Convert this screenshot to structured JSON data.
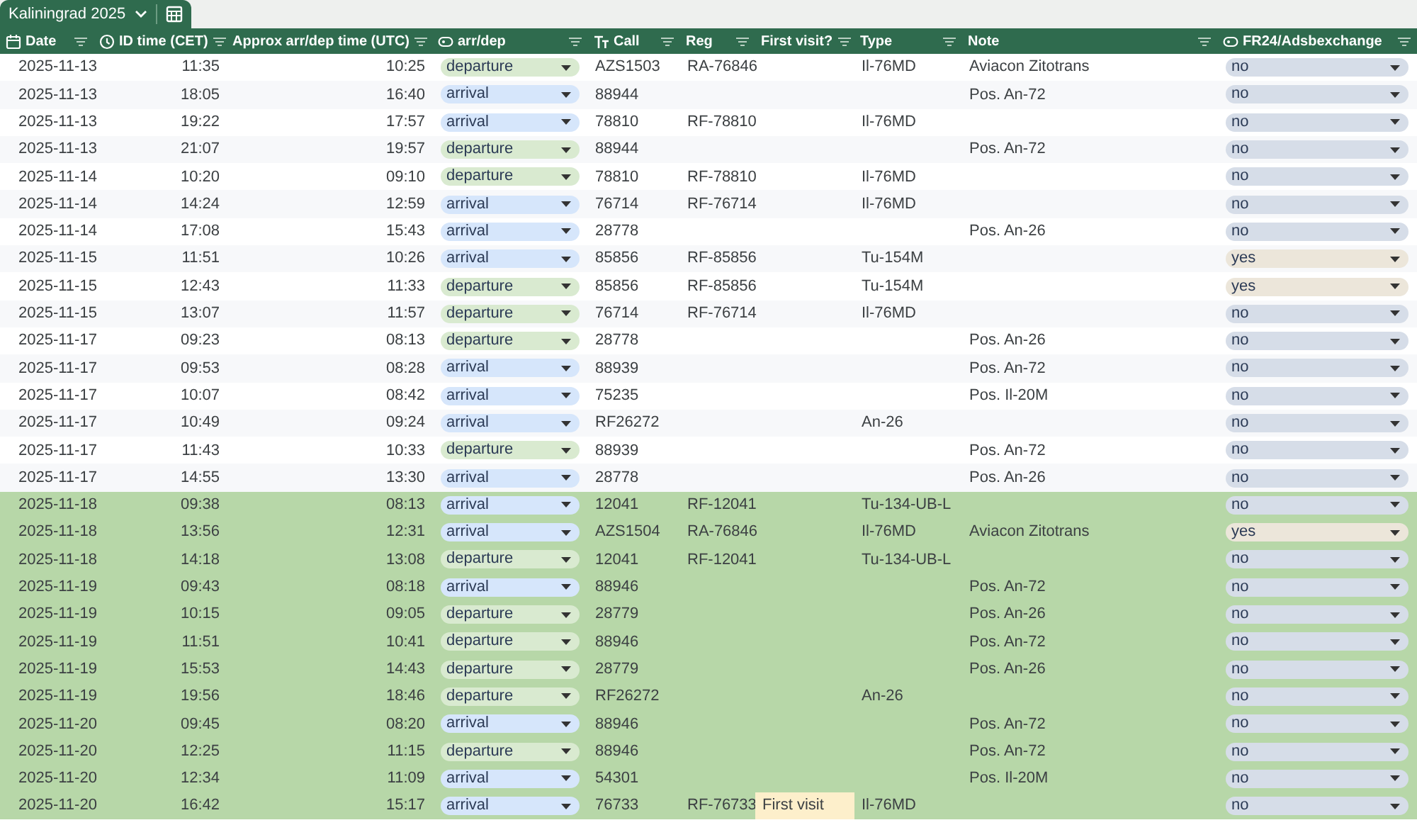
{
  "sheet_tab": {
    "label": "Kaliningrad 2025",
    "selected": true
  },
  "columns": [
    {
      "label": "Date"
    },
    {
      "label": "ID time (CET)"
    },
    {
      "label": "Approx arr/dep time (UTC)"
    },
    {
      "label": "arr/dep"
    },
    {
      "label": "Call"
    },
    {
      "label": "Reg"
    },
    {
      "label": "First visit?"
    },
    {
      "label": "Type"
    },
    {
      "label": "Note"
    },
    {
      "label": "FR24/Adsbexchange"
    }
  ],
  "rows": [
    {
      "date": "2025-11-13",
      "cet": "11:35",
      "utc": "10:25",
      "dir": {
        "text": "departure",
        "color": "#d9ead0"
      },
      "call": "AZS1503",
      "reg": "RA-76846",
      "type": "Il-76MD",
      "note": "Aviacon Zitotrans",
      "fr24": {
        "text": "no",
        "color": "#d6dde8"
      },
      "highlighted": false
    },
    {
      "date": "2025-11-13",
      "cet": "18:05",
      "utc": "16:40",
      "dir": {
        "text": "arrival",
        "color": "#d6e6fb"
      },
      "call": "88944",
      "note": "Pos. An-72",
      "fr24": {
        "text": "no",
        "color": "#d6dde8"
      },
      "highlighted": false
    },
    {
      "date": "2025-11-13",
      "cet": "19:22",
      "utc": "17:57",
      "dir": {
        "text": "arrival",
        "color": "#d6e6fb"
      },
      "call": "78810",
      "reg": "RF-78810",
      "type": "Il-76MD",
      "fr24": {
        "text": "no",
        "color": "#d6dde8"
      },
      "highlighted": false
    },
    {
      "date": "2025-11-13",
      "cet": "21:07",
      "utc": "19:57",
      "dir": {
        "text": "departure",
        "color": "#d9ead0"
      },
      "call": "88944",
      "note": "Pos. An-72",
      "fr24": {
        "text": "no",
        "color": "#d6dde8"
      },
      "highlighted": false
    },
    {
      "date": "2025-11-14",
      "cet": "10:20",
      "utc": "09:10",
      "dir": {
        "text": "departure",
        "color": "#d9ead0"
      },
      "call": "78810",
      "reg": "RF-78810",
      "type": "Il-76MD",
      "fr24": {
        "text": "no",
        "color": "#d6dde8"
      },
      "highlighted": false
    },
    {
      "date": "2025-11-14",
      "cet": "14:24",
      "utc": "12:59",
      "dir": {
        "text": "arrival",
        "color": "#d6e6fb"
      },
      "call": "76714",
      "reg": "RF-76714",
      "type": "Il-76MD",
      "fr24": {
        "text": "no",
        "color": "#d6dde8"
      },
      "highlighted": false
    },
    {
      "date": "2025-11-14",
      "cet": "17:08",
      "utc": "15:43",
      "dir": {
        "text": "arrival",
        "color": "#d6e6fb"
      },
      "call": "28778",
      "note": "Pos. An-26",
      "fr24": {
        "text": "no",
        "color": "#d6dde8"
      },
      "highlighted": false
    },
    {
      "date": "2025-11-15",
      "cet": "11:51",
      "utc": "10:26",
      "dir": {
        "text": "arrival",
        "color": "#d6e6fb"
      },
      "call": "85856",
      "reg": "RF-85856",
      "type": "Tu-154M",
      "fr24": {
        "text": "yes",
        "color": "#ece6da"
      },
      "highlighted": false
    },
    {
      "date": "2025-11-15",
      "cet": "12:43",
      "utc": "11:33",
      "dir": {
        "text": "departure",
        "color": "#d9ead0"
      },
      "call": "85856",
      "reg": "RF-85856",
      "type": "Tu-154M",
      "fr24": {
        "text": "yes",
        "color": "#ece6da"
      },
      "highlighted": false
    },
    {
      "date": "2025-11-15",
      "cet": "13:07",
      "utc": "11:57",
      "dir": {
        "text": "departure",
        "color": "#d9ead0"
      },
      "call": "76714",
      "reg": "RF-76714",
      "type": "Il-76MD",
      "fr24": {
        "text": "no",
        "color": "#d6dde8"
      },
      "highlighted": false
    },
    {
      "date": "2025-11-17",
      "cet": "09:23",
      "utc": "08:13",
      "dir": {
        "text": "departure",
        "color": "#d9ead0"
      },
      "call": "28778",
      "note": "Pos. An-26",
      "fr24": {
        "text": "no",
        "color": "#d6dde8"
      },
      "highlighted": false
    },
    {
      "date": "2025-11-17",
      "cet": "09:53",
      "utc": "08:28",
      "dir": {
        "text": "arrival",
        "color": "#d6e6fb"
      },
      "call": "88939",
      "note": "Pos. An-72",
      "fr24": {
        "text": "no",
        "color": "#d6dde8"
      },
      "highlighted": false
    },
    {
      "date": "2025-11-17",
      "cet": "10:07",
      "utc": "08:42",
      "dir": {
        "text": "arrival",
        "color": "#d6e6fb"
      },
      "call": "75235",
      "note": "Pos. Il-20M",
      "fr24": {
        "text": "no",
        "color": "#d6dde8"
      },
      "highlighted": false
    },
    {
      "date": "2025-11-17",
      "cet": "10:49",
      "utc": "09:24",
      "dir": {
        "text": "arrival",
        "color": "#d6e6fb"
      },
      "call": "RF26272",
      "type": "An-26",
      "fr24": {
        "text": "no",
        "color": "#d6dde8"
      },
      "highlighted": false
    },
    {
      "date": "2025-11-17",
      "cet": "11:43",
      "utc": "10:33",
      "dir": {
        "text": "departure",
        "color": "#d9ead0"
      },
      "call": "88939",
      "note": "Pos. An-72",
      "fr24": {
        "text": "no",
        "color": "#d6dde8"
      },
      "highlighted": false
    },
    {
      "date": "2025-11-17",
      "cet": "14:55",
      "utc": "13:30",
      "dir": {
        "text": "arrival",
        "color": "#d6e6fb"
      },
      "call": "28778",
      "note": "Pos. An-26",
      "fr24": {
        "text": "no",
        "color": "#d6dde8"
      },
      "highlighted": false
    },
    {
      "date": "2025-11-18",
      "cet": "09:38",
      "utc": "08:13",
      "dir": {
        "text": "arrival",
        "color": "#d6e6fb"
      },
      "call": "12041",
      "reg": "RF-12041",
      "type": "Tu-134-UB-L",
      "fr24": {
        "text": "no",
        "color": "#d6dde8"
      },
      "highlighted": true
    },
    {
      "date": "2025-11-18",
      "cet": "13:56",
      "utc": "12:31",
      "dir": {
        "text": "arrival",
        "color": "#d6e6fb"
      },
      "call": "AZS1504",
      "reg": "RA-76846",
      "type": "Il-76MD",
      "note": "Aviacon Zitotrans",
      "fr24": {
        "text": "yes",
        "color": "#ece6da"
      },
      "highlighted": true
    },
    {
      "date": "2025-11-18",
      "cet": "14:18",
      "utc": "13:08",
      "dir": {
        "text": "departure",
        "color": "#d9ead0"
      },
      "call": "12041",
      "reg": "RF-12041",
      "type": "Tu-134-UB-L",
      "fr24": {
        "text": "no",
        "color": "#d6dde8"
      },
      "highlighted": true
    },
    {
      "date": "2025-11-19",
      "cet": "09:43",
      "utc": "08:18",
      "dir": {
        "text": "arrival",
        "color": "#d6e6fb"
      },
      "call": "88946",
      "note": "Pos. An-72",
      "fr24": {
        "text": "no",
        "color": "#d6dde8"
      },
      "highlighted": true
    },
    {
      "date": "2025-11-19",
      "cet": "10:15",
      "utc": "09:05",
      "dir": {
        "text": "departure",
        "color": "#d9ead0"
      },
      "call": "28779",
      "note": "Pos. An-26",
      "fr24": {
        "text": "no",
        "color": "#d6dde8"
      },
      "highlighted": true
    },
    {
      "date": "2025-11-19",
      "cet": "11:51",
      "utc": "10:41",
      "dir": {
        "text": "departure",
        "color": "#d9ead0"
      },
      "call": "88946",
      "note": "Pos. An-72",
      "fr24": {
        "text": "no",
        "color": "#d6dde8"
      },
      "highlighted": true
    },
    {
      "date": "2025-11-19",
      "cet": "15:53",
      "utc": "14:43",
      "dir": {
        "text": "departure",
        "color": "#d9ead0"
      },
      "call": "28779",
      "note": "Pos. An-26",
      "fr24": {
        "text": "no",
        "color": "#d6dde8"
      },
      "highlighted": true
    },
    {
      "date": "2025-11-19",
      "cet": "19:56",
      "utc": "18:46",
      "dir": {
        "text": "departure",
        "color": "#d9ead0"
      },
      "call": "RF26272",
      "type": "An-26",
      "fr24": {
        "text": "no",
        "color": "#d6dde8"
      },
      "highlighted": true
    },
    {
      "date": "2025-11-20",
      "cet": "09:45",
      "utc": "08:20",
      "dir": {
        "text": "arrival",
        "color": "#d6e6fb"
      },
      "call": "88946",
      "note": "Pos. An-72",
      "fr24": {
        "text": "no",
        "color": "#d6dde8"
      },
      "highlighted": true
    },
    {
      "date": "2025-11-20",
      "cet": "12:25",
      "utc": "11:15",
      "dir": {
        "text": "departure",
        "color": "#d9ead0"
      },
      "call": "88946",
      "note": "Pos. An-72",
      "fr24": {
        "text": "no",
        "color": "#d6dde8"
      },
      "highlighted": true
    },
    {
      "date": "2025-11-20",
      "cet": "12:34",
      "utc": "11:09",
      "dir": {
        "text": "arrival",
        "color": "#d6e6fb"
      },
      "call": "54301",
      "note": "Pos. Il-20M",
      "fr24": {
        "text": "no",
        "color": "#d6dde8"
      },
      "highlighted": true
    },
    {
      "date": "2025-11-20",
      "cet": "16:42",
      "utc": "15:17",
      "dir": {
        "text": "arrival",
        "color": "#d6e6fb"
      },
      "call": "76733",
      "reg": "RF-76733",
      "first_visit": "First visit",
      "type": "Il-76MD",
      "fr24": {
        "text": "no",
        "color": "#d6dde8"
      },
      "highlighted": true
    }
  ]
}
